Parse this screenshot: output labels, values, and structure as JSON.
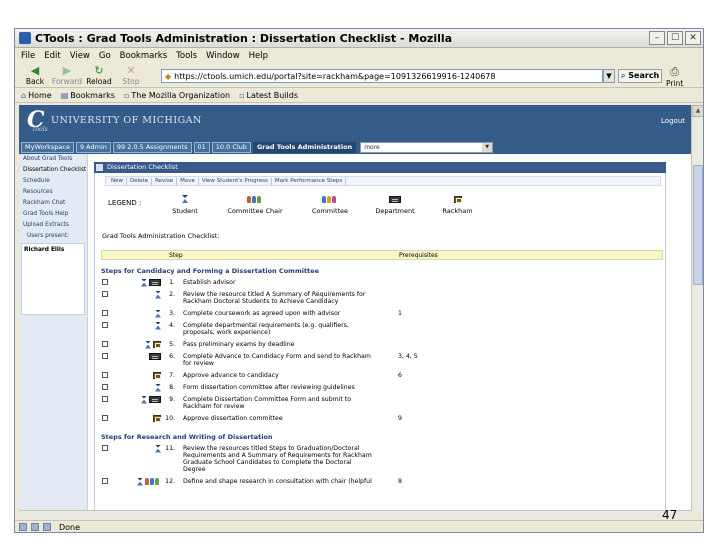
{
  "window": {
    "title": "CTools : Grad Tools Administration : Dissertation Checklist - Mozilla",
    "minimize": "–",
    "maximize": "☐",
    "close": "✕"
  },
  "menu": [
    "File",
    "Edit",
    "View",
    "Go",
    "Bookmarks",
    "Tools",
    "Window",
    "Help"
  ],
  "nav": {
    "back": "Back",
    "forward": "Forward",
    "reload": "Reload",
    "stop": "Stop",
    "url": "https://ctools.umich.edu/portal?site=rackham&page=1091326619916-1240678",
    "search": "Search",
    "print": "Print"
  },
  "bookmarks": [
    "Home",
    "Bookmarks",
    "The Mozilla Organization",
    "Latest Builds"
  ],
  "portal": {
    "logo_c": "C",
    "logo_tools": "Tools",
    "logo_um": "UNIVERSITY OF MICHIGAN",
    "logout": "Logout",
    "tabs": [
      "MyWorkspace",
      "9 Admin",
      "99 2.0.5 Assignments",
      "01",
      "10.0 Club",
      "Grad Tools Administration"
    ],
    "site_select": "more"
  },
  "leftnav": {
    "items": [
      "About Grad Tools",
      "Dissertation Checklist",
      "Schedule",
      "Resources",
      "Rackham Chat",
      "Grad Tools Help",
      "Upload Extracts"
    ],
    "users_present": "Users present:",
    "present_user": "Richard Ellis"
  },
  "tool": {
    "header": "Dissertation Checklist",
    "actions": [
      "New",
      "Delete",
      "Revise",
      "Move",
      "View Student's Progress",
      "Mark Performance Steps"
    ],
    "legend_label": "LEGEND :",
    "legend": [
      "Student",
      "Committee Chair",
      "Committee",
      "Department",
      "Rackham"
    ],
    "checklist_title": "Grad Tools Administration Checklist:",
    "col_step": "Step",
    "col_prereq": "Prerequisites",
    "sections": [
      {
        "title": "Steps for Candidacy and Forming a Dissertation Committee",
        "rows": [
          {
            "num": "1.",
            "pre": "",
            "lines": [
              "Establish advisor"
            ],
            "icons": [
              "student",
              "dept"
            ]
          },
          {
            "num": "2.",
            "pre": "",
            "lines": [
              "Review the resource titled A Summary of Requirements for",
              "Rackham Doctoral Students to Achieve Candidacy"
            ],
            "icons": [
              "student"
            ]
          },
          {
            "num": "3.",
            "pre": "1",
            "lines": [
              "Complete coursework as agreed upon with advisor"
            ],
            "icons": [
              "student"
            ]
          },
          {
            "num": "4.",
            "pre": "",
            "lines": [
              "Complete departmental requirements (e.g. qualifiers,",
              "proposals, work experience)"
            ],
            "icons": [
              "student"
            ]
          },
          {
            "num": "5.",
            "pre": "",
            "lines": [
              "Pass preliminary exams by deadline"
            ],
            "icons": [
              "student",
              "rack"
            ]
          },
          {
            "num": "6.",
            "pre": "3, 4, 5",
            "lines": [
              "Complete Advance to Candidacy Form and send to Rackham",
              "for review"
            ],
            "icons": [
              "dept"
            ]
          },
          {
            "num": "7.",
            "pre": "6",
            "lines": [
              "Approve advance to candidacy"
            ],
            "icons": [
              "rack"
            ]
          },
          {
            "num": "8.",
            "pre": "",
            "lines": [
              "Form dissertation committee after reviewing guidelines"
            ],
            "icons": [
              "student"
            ]
          },
          {
            "num": "9.",
            "pre": "",
            "lines": [
              "Complete Dissertation Committee Form and submit to",
              "Rackham for review"
            ],
            "icons": [
              "student",
              "dept"
            ]
          },
          {
            "num": "10.",
            "pre": "9",
            "lines": [
              "Approve dissertation committee"
            ],
            "icons": [
              "rack"
            ]
          }
        ]
      },
      {
        "title": "Steps for Research and Writing of Dissertation",
        "rows": [
          {
            "num": "11.",
            "pre": "",
            "lines": [
              "Review the resources titled Steps to Graduation/Doctoral",
              "Requirements and A Summary of Requirements for Rackham",
              "Graduate School Candidates to Complete the Doctoral",
              "Degree"
            ],
            "icons": [
              "student"
            ]
          },
          {
            "num": "12.",
            "pre": "8",
            "lines": [
              "Define and shape research in consultation with chair (helpful"
            ],
            "icons": [
              "student",
              "cc"
            ]
          }
        ]
      }
    ]
  },
  "status": {
    "text": "Done"
  },
  "page_number": "47",
  "colors": {
    "banner": "#355b88",
    "tool_header": "#39598a",
    "link": "#1d4f9c",
    "table_header": "#f6f6c8"
  }
}
